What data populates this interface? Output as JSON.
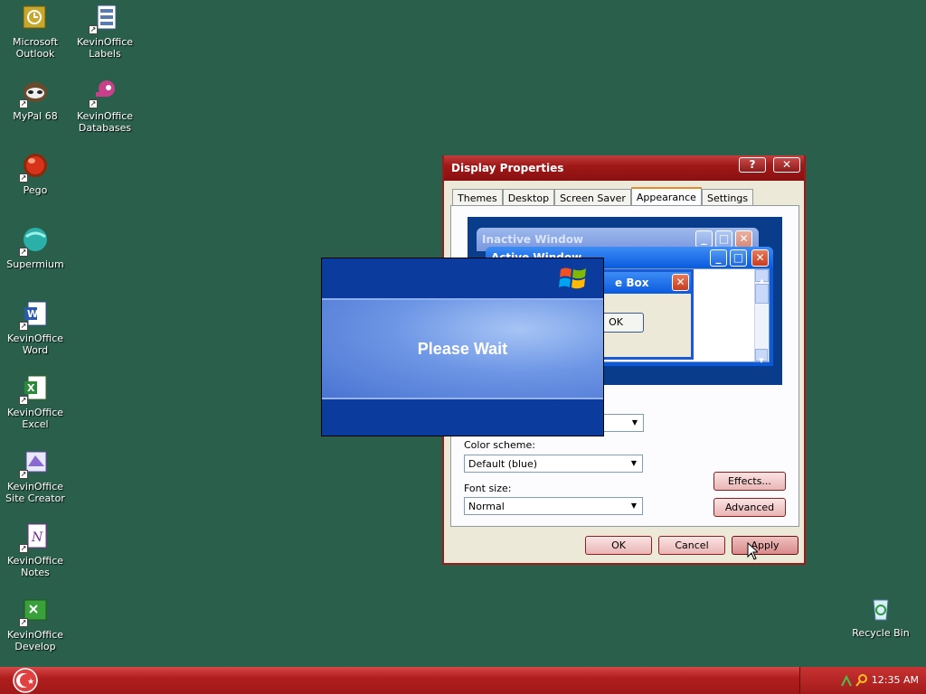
{
  "desktop": {
    "icons": [
      {
        "label": "Microsoft\nOutlook"
      },
      {
        "label": "KevinOffice\nLabels"
      },
      {
        "label": "MyPal 68"
      },
      {
        "label": "KevinOffice\nDatabases"
      },
      {
        "label": "Pego"
      },
      {
        "label": "Supermium"
      },
      {
        "label": "KevinOffice\nWord"
      },
      {
        "label": "KevinOffice\nExcel"
      },
      {
        "label": "KevinOffice\nSite Creator"
      },
      {
        "label": "KevinOffice\nNotes"
      },
      {
        "label": "KevinOffice\nDevelop"
      },
      {
        "label": "Recycle Bin"
      }
    ]
  },
  "dialog": {
    "title": "Display Properties",
    "help_label": "?",
    "close_label": "✕",
    "tabs": [
      "Themes",
      "Desktop",
      "Screen Saver",
      "Appearance",
      "Settings"
    ],
    "active_tab": "Appearance",
    "preview": {
      "inactive_title": "Inactive Window",
      "active_title": "Active Window",
      "message_title": "Message Box",
      "message_title_visible": "e Box",
      "ok_label": "OK"
    },
    "color_scheme_label": "Color scheme:",
    "color_scheme_value": "Default (blue)",
    "font_size_label": "Font size:",
    "font_size_value": "Normal",
    "effects_label": "Effects...",
    "advanced_label": "Advanced",
    "ok_label": "OK",
    "cancel_label": "Cancel",
    "apply_label": "Apply"
  },
  "wait_overlay": {
    "text": "Please Wait"
  },
  "taskbar": {
    "clock": "12:35 AM"
  },
  "colors": {
    "desktop": "#2a5f4c",
    "titlebar": "#a01818",
    "taskbar": "#b01e1e",
    "wait_band": "#0a3b9d"
  }
}
